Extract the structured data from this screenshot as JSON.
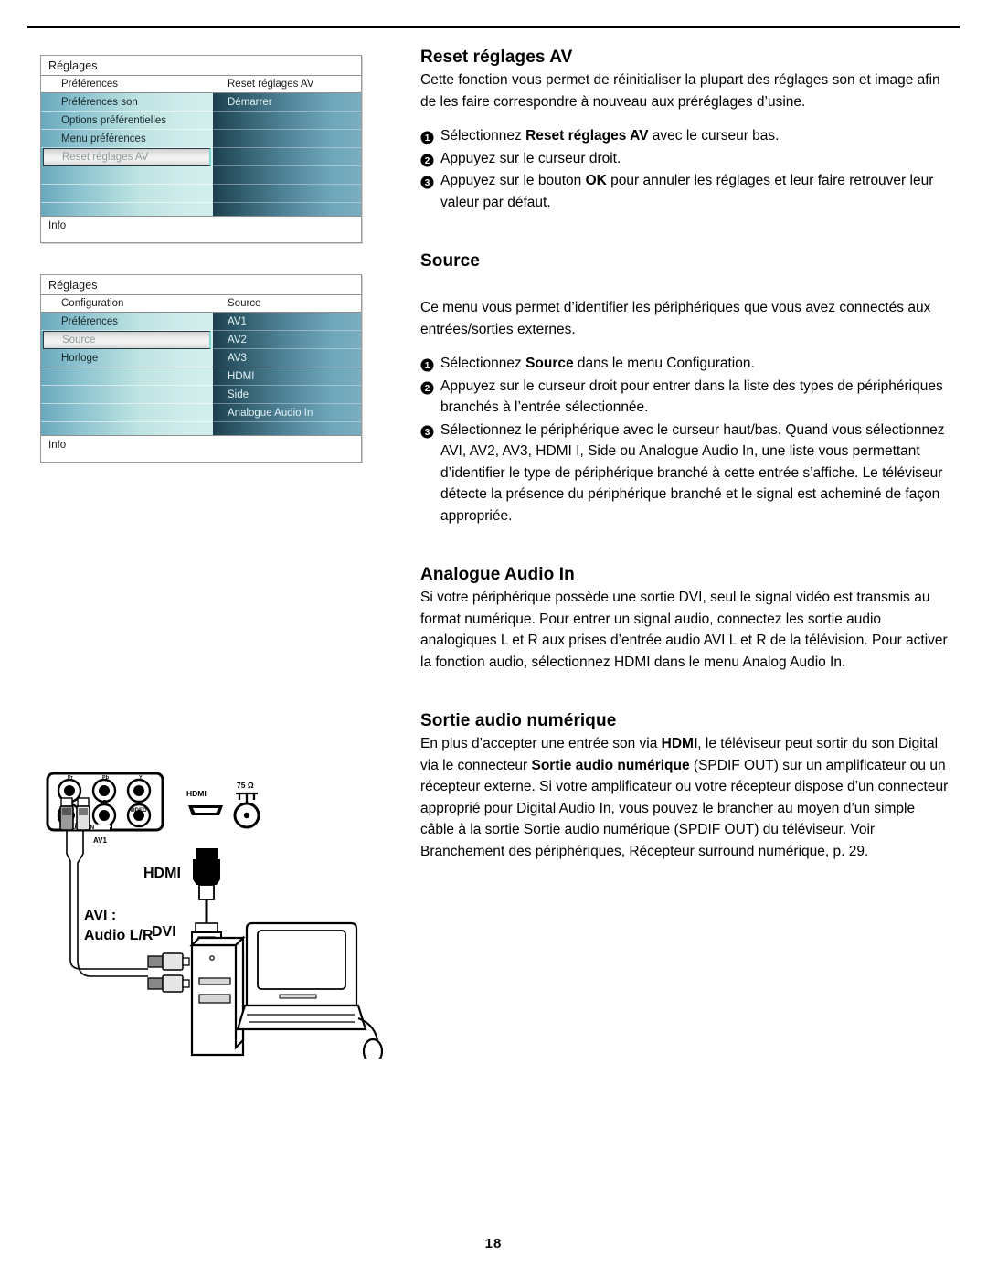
{
  "page": {
    "number": "18"
  },
  "osd_menus": [
    {
      "title": "Réglages",
      "head_left": "Préférences",
      "head_right": "Reset réglages AV",
      "footer": "Info",
      "left_items": [
        {
          "label": "Préférences son",
          "selected": false
        },
        {
          "label": "Options préférentielles",
          "selected": false
        },
        {
          "label": "Menu préférences",
          "selected": false
        },
        {
          "label": "Reset réglages AV",
          "selected": true
        },
        {
          "label": "",
          "selected": false
        },
        {
          "label": "",
          "selected": false
        },
        {
          "label": "",
          "selected": false
        }
      ],
      "right_items": [
        {
          "label": "Démarrer"
        },
        {
          "label": ""
        },
        {
          "label": ""
        },
        {
          "label": ""
        },
        {
          "label": ""
        },
        {
          "label": ""
        },
        {
          "label": ""
        }
      ]
    },
    {
      "title": "Réglages",
      "head_left": "Configuration",
      "head_right": "Source",
      "footer": "Info",
      "left_items": [
        {
          "label": "Préférences",
          "selected": false
        },
        {
          "label": "Source",
          "selected": true
        },
        {
          "label": "Horloge",
          "selected": false
        },
        {
          "label": "",
          "selected": false
        },
        {
          "label": "",
          "selected": false
        },
        {
          "label": "",
          "selected": false
        },
        {
          "label": "",
          "selected": false
        }
      ],
      "right_items": [
        {
          "label": "AV1"
        },
        {
          "label": "AV2"
        },
        {
          "label": "AV3"
        },
        {
          "label": "HDMI"
        },
        {
          "label": "Side"
        },
        {
          "label": "Analogue Audio In"
        },
        {
          "label": ""
        }
      ]
    }
  ],
  "sections": {
    "reset": {
      "heading": "Reset réglages AV",
      "intro": "Cette fonction vous permet de réinitialiser la plupart des réglages son et image afin de les faire correspondre à nouveau aux préréglages d’usine.",
      "steps": [
        {
          "num": "1",
          "pre": "Sélectionnez ",
          "bold": "Reset réglages AV",
          "post": " avec le curseur bas."
        },
        {
          "num": "2",
          "pre": "Appuyez sur le curseur droit.",
          "bold": "",
          "post": ""
        },
        {
          "num": "3",
          "pre": "Appuyez sur le bouton ",
          "bold": "OK",
          "post": " pour annuler les réglages et leur faire retrouver leur valeur par défaut."
        }
      ]
    },
    "source": {
      "heading": "Source",
      "intro": "Ce menu vous permet d’identifier les périphériques que vous avez connectés aux entrées/sorties externes.",
      "steps": [
        {
          "num": "1",
          "pre": "Sélectionnez ",
          "bold": "Source",
          "post": " dans le menu Configuration."
        },
        {
          "num": "2",
          "pre": "Appuyez sur le curseur droit pour entrer dans la liste des types de périphériques branchés à l’entrée sélectionnée.",
          "bold": "",
          "post": ""
        },
        {
          "num": "3",
          "pre": "Sélectionnez le périphérique avec le curseur haut/bas. Quand vous sélectionnez AVI, AV2, AV3, HDMI I, Side ou Analogue Audio In, une liste vous permettant d’identifier le type de périphérique branché à cette entrée s’affiche. Le téléviseur détecte la présence du périphérique branché et le signal est acheminé de façon appropriée.",
          "bold": "",
          "post": ""
        }
      ]
    },
    "analogue": {
      "heading": "Analogue Audio In",
      "intro": "Si votre périphérique possède une sortie DVI, seul le signal vidéo est transmis au format numérique. Pour entrer un signal audio, connectez les sortie audio analogiques L et R aux prises d’entrée audio AVI L et R de la télévision. Pour activer la fonction audio, sélectionnez HDMI dans le menu Analog Audio In."
    },
    "spdif": {
      "heading": "Sortie audio numérique",
      "part1": "En plus d’accepter une entrée son via ",
      "bold1": "HDMI",
      "part2": ", le téléviseur peut sortir du son Digital via le connecteur ",
      "bold2": "Sortie audio numérique",
      "part3": " (SPDIF OUT) sur un amplificateur ou un récepteur externe. Si votre amplificateur ou votre récepteur dispose d’un connecteur approprié pour Digital Audio In, vous pouvez le brancher au moyen d’un simple câble à la sortie Sortie audio numérique (SPDIF OUT) du téléviseur. Voir Branchement des périphériques, Récepteur surround numérique, p. 29."
    }
  },
  "diagram": {
    "panel_labels": {
      "pr": "Pr",
      "pb": "Pb",
      "y": "Y",
      "l": "L",
      "r": "R",
      "video": "VIDEO",
      "audio_in": "AUDIO IN",
      "av1": "AV1"
    },
    "hdmi_port_label": "HDMI",
    "antenna_label": "75 Ω",
    "cable_hdmi_label": "HDMI",
    "cable_dvi_label": "DVI",
    "cable_audio_label_1": "AVI :",
    "cable_audio_label_2": "Audio L/R"
  }
}
